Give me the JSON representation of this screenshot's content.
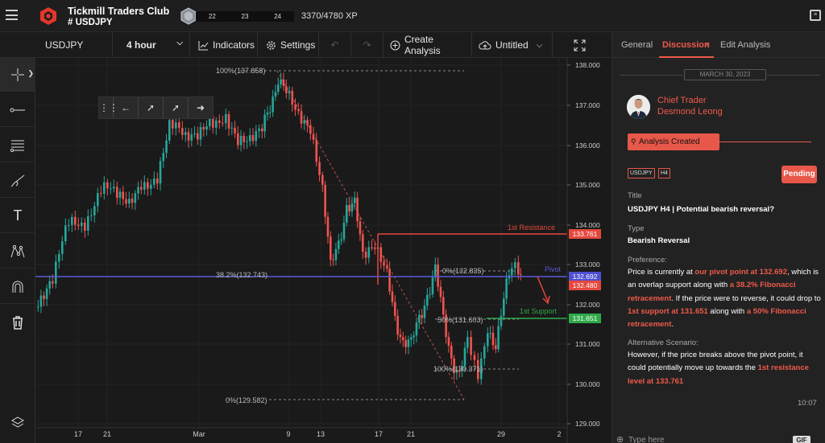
{
  "header": {
    "club_name": "Tickmill Traders Club",
    "channel": "# USDJPY",
    "xp_segments": [
      "22",
      "23",
      "24"
    ],
    "xp_text": "3370/4780 XP"
  },
  "toolbar": {
    "symbol": "USDJPY",
    "timeframe": "4 hour",
    "indicators": "Indicators",
    "settings": "Settings",
    "create_analysis": "Create Analysis",
    "layout_name": "Untitled"
  },
  "sidebar": {
    "tools": [
      "crosshair-icon",
      "line-icon",
      "fib-retracement-icon",
      "brush-icon",
      "text-icon",
      "pattern-icon",
      "magnet-icon",
      "trash-icon",
      "layers-icon"
    ]
  },
  "chart": {
    "price_ticks": [
      "138.000",
      "137.000",
      "136.000",
      "135.000",
      "134.000",
      "133.000",
      "132.000",
      "131.000",
      "130.000",
      "129.000"
    ],
    "time_ticks": [
      "17",
      "21",
      "Mar",
      "9",
      "13",
      "17",
      "21",
      "29",
      "2"
    ],
    "fib_top": [
      "100%(137.858)",
      "38.2%(132.743)",
      "0%(129.582)"
    ],
    "fib_bottom": [
      "0%(132.835)",
      "50%(131.603)",
      "100%(130.371)"
    ],
    "resistance_label": "1st Resistance",
    "resistance_value": "133.761",
    "pivot_label": "Pivot",
    "pivot_value": "132.692",
    "current_value": "132.480",
    "support_label": "1st Support",
    "support_value": "131.651",
    "colors": {
      "up": "#26a69a",
      "down": "#ef5350",
      "pivot": "#5b5bd6",
      "resistance": "#e5483d",
      "support": "#2faa4a"
    }
  },
  "panel": {
    "tabs": [
      "General",
      "Discussion",
      "Edit Analysis"
    ],
    "date": "MARCH 30, 2023",
    "role": "Chief Trader",
    "author": "Desmond Leong",
    "status_banner": "Analysis Created",
    "tags": [
      "USDJPY",
      "H4"
    ],
    "status": "Pending",
    "title_label": "Title",
    "title": "USDJPY H4 | Potential bearish reversal?",
    "type_label": "Type",
    "type": "Bearish Reversal",
    "preference_label": "Preference:",
    "preference": [
      {
        "t": "Price is currently at ",
        "hl": false
      },
      {
        "t": "our pivot point at 132.692",
        "hl": true
      },
      {
        "t": ", which is an overlap support along with ",
        "hl": false
      },
      {
        "t": "a 38.2% Fibonacci retracement",
        "hl": true
      },
      {
        "t": ". If the price were to reverse, it could drop to ",
        "hl": false
      },
      {
        "t": "1st support at 131.651",
        "hl": true
      },
      {
        "t": " along with ",
        "hl": false
      },
      {
        "t": "a 50% Fibonacci retracement",
        "hl": true
      },
      {
        "t": ".",
        "hl": false
      }
    ],
    "alt_label": "Alternative Scenario:",
    "alternative": [
      {
        "t": "However, if the price breaks above the pivot point, it could potentially move up towards the ",
        "hl": false
      },
      {
        "t": "1st resistance level at 133.761",
        "hl": true
      }
    ],
    "time": "10:07",
    "input_placeholder": "Type here",
    "gif_label": "GIF"
  }
}
